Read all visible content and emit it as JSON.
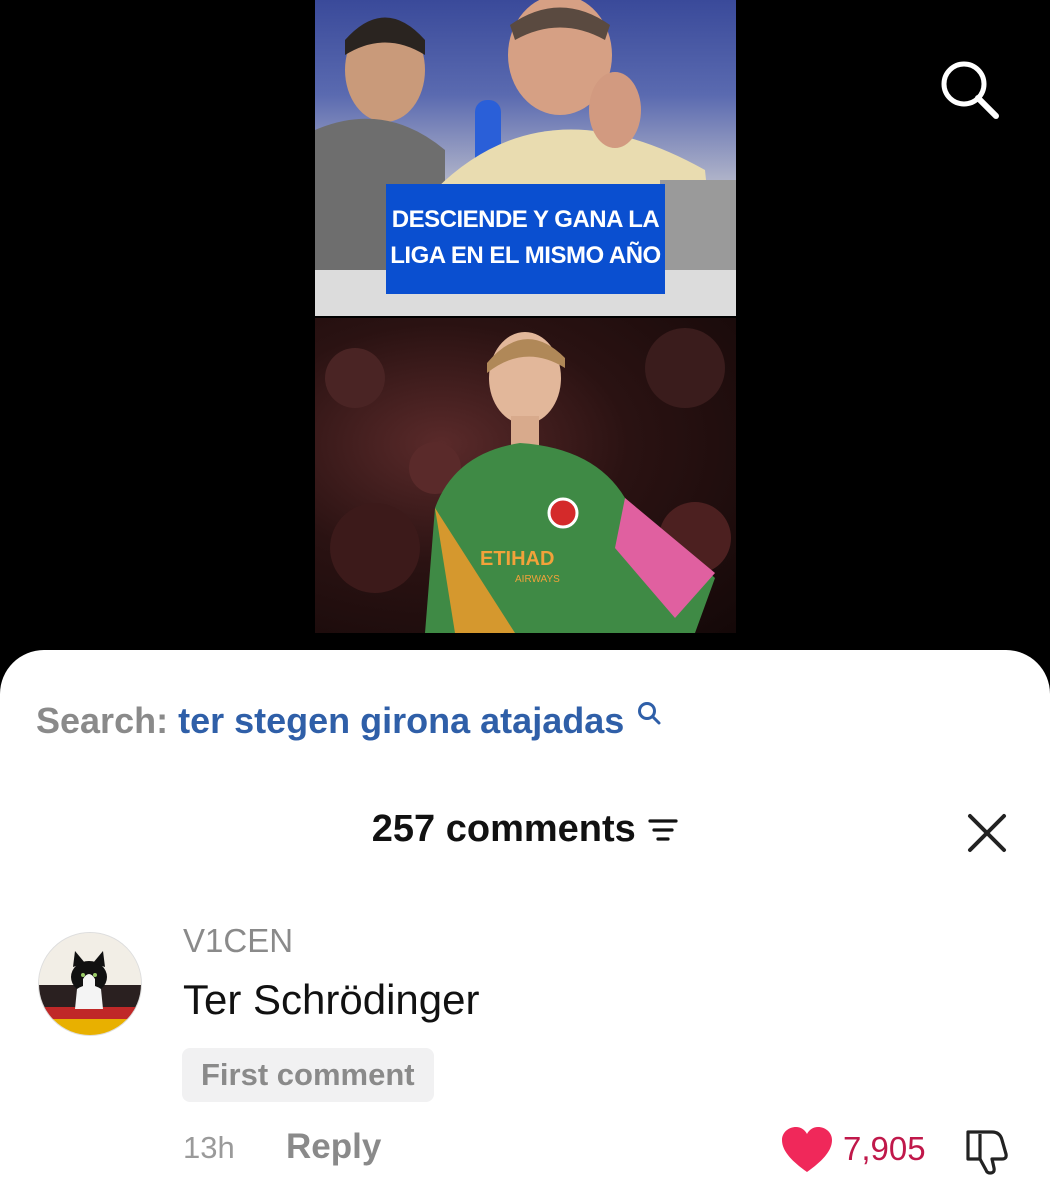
{
  "video": {
    "caption_line1": "DESCIENDE Y GANA LA",
    "caption_line2": "LIGA EN EL MISMO AÑO",
    "jersey_text": "ETIHAD",
    "jersey_text2": "AIRWAYS"
  },
  "search": {
    "label": "Search:",
    "query": "ter stegen girona atajadas"
  },
  "comments": {
    "count_label": "257 comments"
  },
  "comment": {
    "username": "V1CEN",
    "text": "Ter Schrödinger",
    "badge": "First comment",
    "time": "13h",
    "reply_label": "Reply",
    "likes": "7,905"
  },
  "colors": {
    "sheet_background": "#ffffff",
    "search_query": "#2f5fa8",
    "caption_background": "#0a4fd0",
    "like_heart": "#f0285a",
    "like_count": "#c0184a"
  },
  "icons": [
    "search-icon",
    "sort-icon",
    "close-icon",
    "heart-icon",
    "dislike-icon"
  ]
}
